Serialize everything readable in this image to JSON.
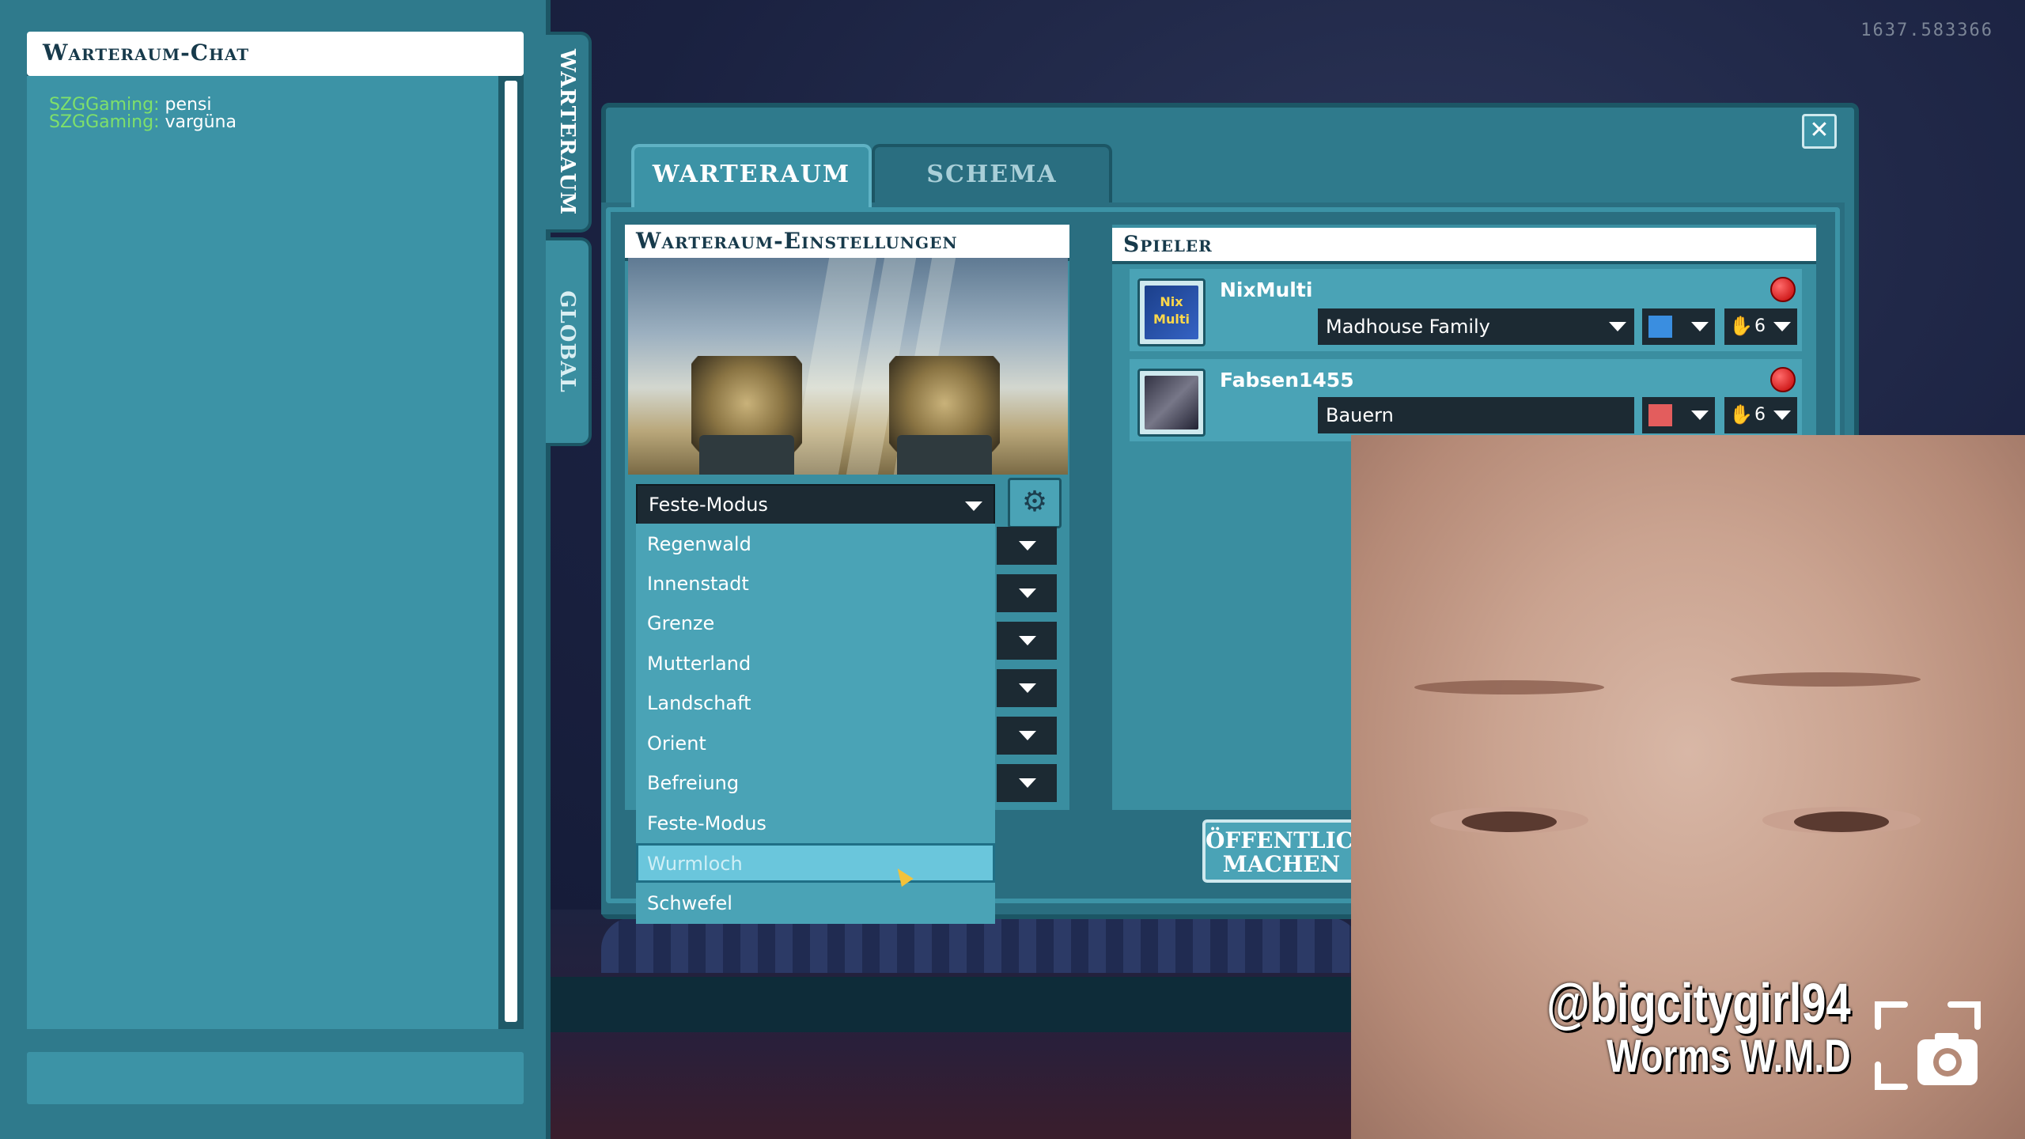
{
  "fps_counter": "1637.583366",
  "chat": {
    "title": "Warteraum-Chat",
    "messages": [
      {
        "user": "SZGGaming:",
        "text": "pensi"
      },
      {
        "user": "SZGGaming:",
        "text": "vargüna"
      }
    ]
  },
  "side_tabs": {
    "lobby": "WARTERAUM",
    "global": "GLOBAL"
  },
  "main_tabs": {
    "lobby": "WARTERAUM",
    "scheme": "SCHEMA"
  },
  "settings": {
    "title": "Warteraum-Einstellungen",
    "selected_scheme": "Feste-Modus",
    "scheme_options": [
      "Regenwald",
      "Innenstadt",
      "Grenze",
      "Mutterland",
      "Landschaft",
      "Orient",
      "Befreiung",
      "Feste-Modus",
      "Wurmloch",
      "Schwefel"
    ],
    "hovered_option": "Wurmloch"
  },
  "players": {
    "title": "Spieler",
    "list": [
      {
        "name": "NixMulti",
        "team": "Madhouse Family",
        "color": "#3a8ee0",
        "health": "6",
        "avatar_text": "Nix Multi"
      },
      {
        "name": "Fabsen1455",
        "team": "Bauern",
        "color": "#e35d5d",
        "health": "6"
      }
    ]
  },
  "public_button": "ÖFFENTLICH MACHEN",
  "stream_overlay": {
    "handle": "@bigcitygirl94",
    "game": "Worms W.M.D"
  },
  "colors": {
    "panel": "#2f7a8c",
    "accent": "#4aa3b6",
    "dark_field": "#1c2a33",
    "chat_username": "#7fe06a"
  }
}
